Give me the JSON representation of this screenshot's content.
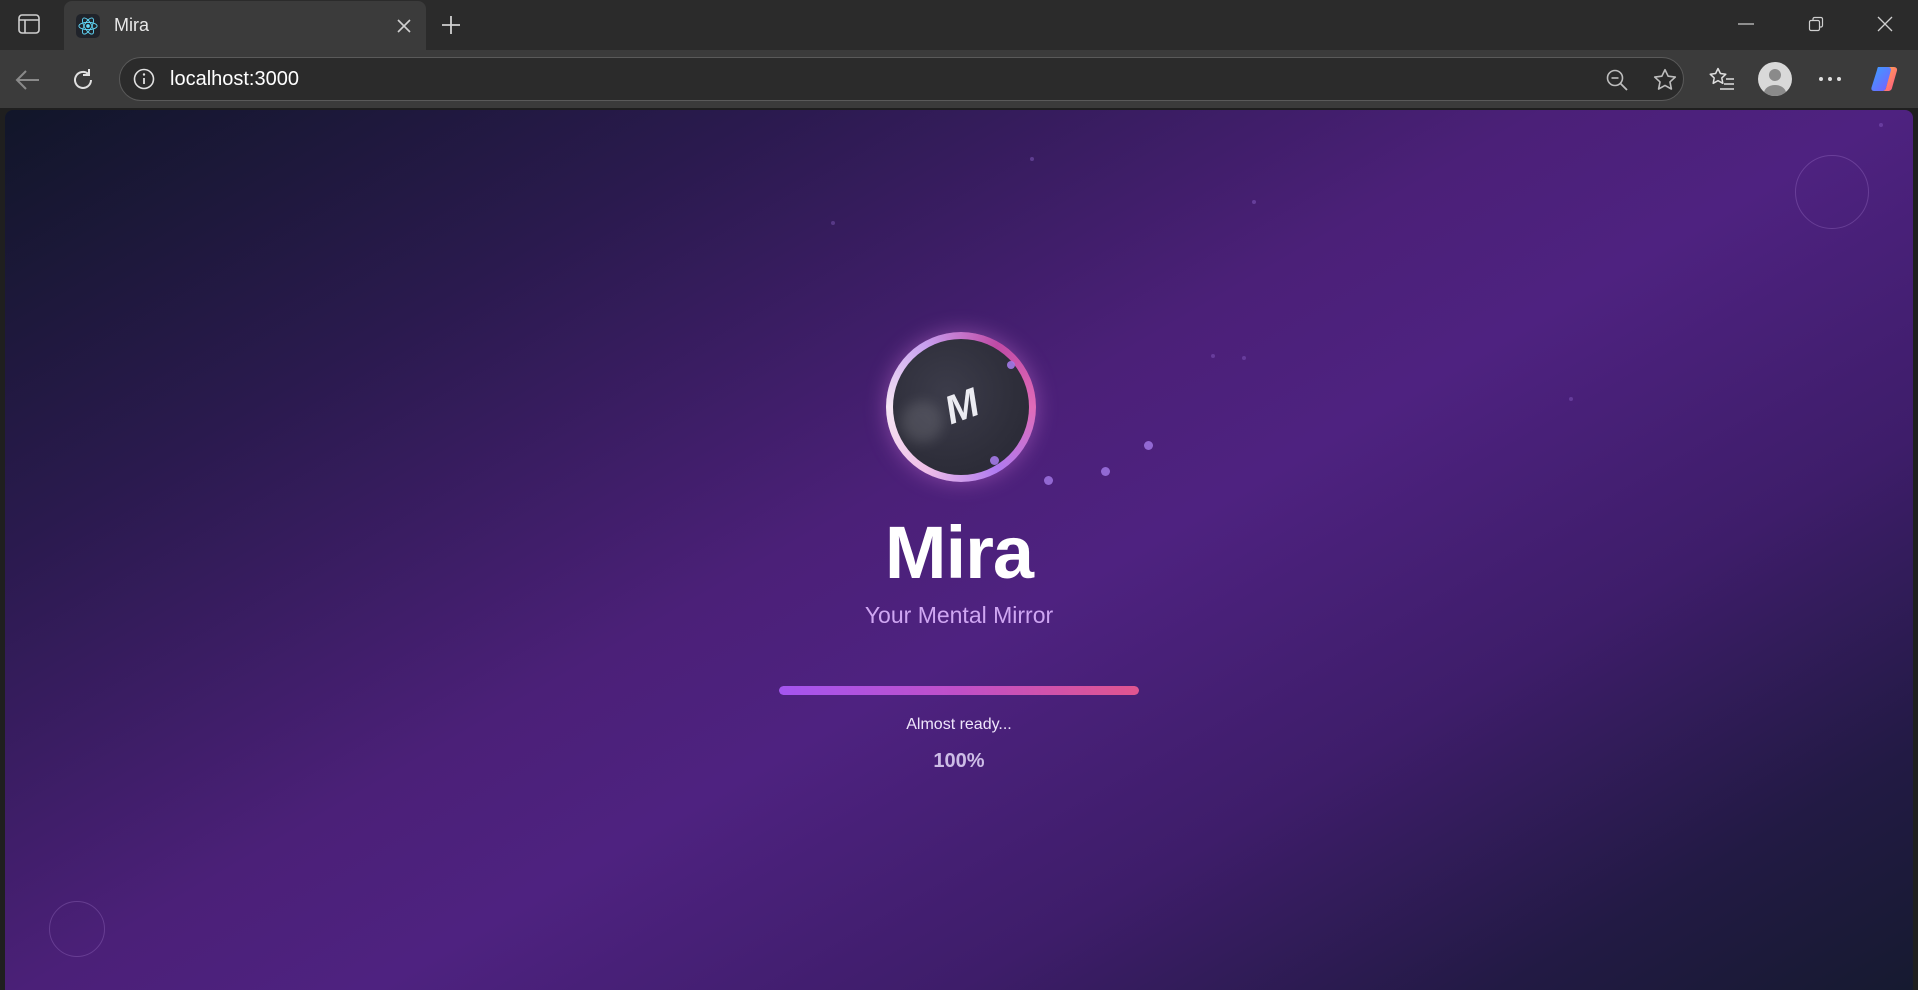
{
  "browser": {
    "tab": {
      "title": "Mira"
    },
    "address_bar": {
      "url": "localhost:3000"
    }
  },
  "app": {
    "name": "Mira",
    "logo_letter": "M",
    "tagline": "Your Mental Mirror",
    "loading": {
      "status": "Almost ready...",
      "percent_label": "100%",
      "progress": 1.0
    }
  },
  "colors": {
    "accent_purple": "#a455f0",
    "accent_pink": "#e0558f",
    "tagline": "#cfa6f2"
  }
}
